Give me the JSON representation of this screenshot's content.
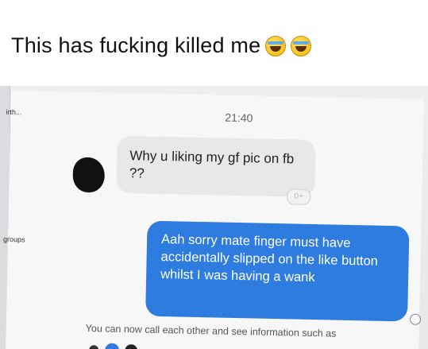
{
  "caption": {
    "text": "This has fucking killed me",
    "emojis": [
      "rolling-laughing-emoji",
      "rolling-laughing-emoji"
    ]
  },
  "screen": {
    "side_label_top": "irth...",
    "side_label_groups": "groups",
    "timestamp": "21:40",
    "incoming": {
      "text": "Why u liking my gf pic on fb ??"
    },
    "reaction": "0+",
    "outgoing": {
      "text": "Aah sorry mate finger must have accidentally slipped on the like button whilst I was having a wank"
    },
    "footer": "You can now call each other and see information such as"
  },
  "colors": {
    "outgoing_bubble": "#2f7ce0",
    "incoming_bubble": "#e8e8ea"
  }
}
